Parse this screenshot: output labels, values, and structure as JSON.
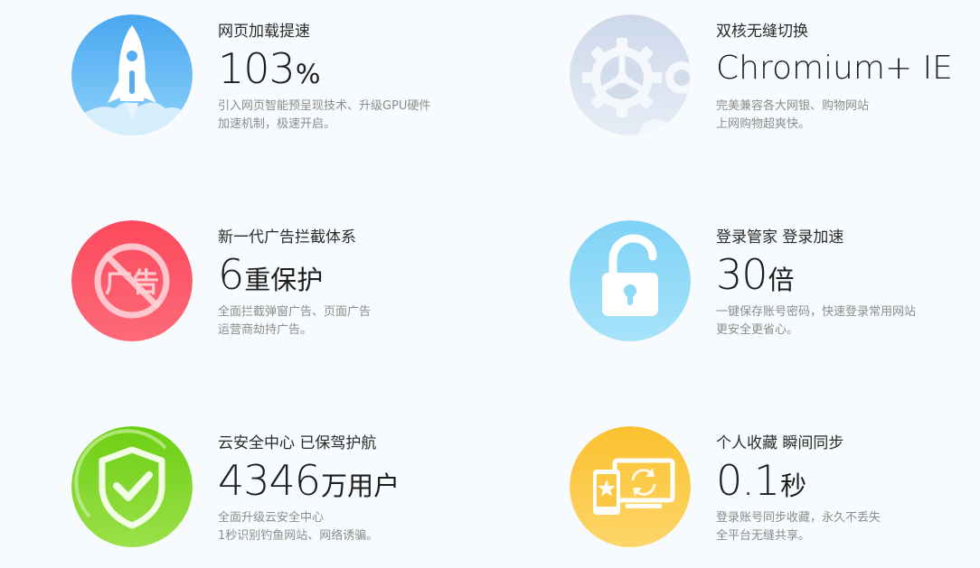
{
  "features": [
    {
      "title": "网页加载提速",
      "metric_num": "103",
      "metric_unit": "%",
      "desc_line1": "引入网页智能预呈现技术、升级GPU硬件",
      "desc_line2": "加速机制，极速开启。",
      "icon": "rocket-icon",
      "color": "#62b8f5"
    },
    {
      "title": "双核无缝切换",
      "metric_num": "Chromium+ IE",
      "metric_unit": "",
      "desc_line1": "完美兼容各大网银、购物网站",
      "desc_line2": "上网购物超爽快。",
      "icon": "gear-icon",
      "color": "#d7e1ef"
    },
    {
      "title": "新一代广告拦截体系",
      "metric_num": "6",
      "metric_unit": "重保护",
      "desc_line1": "全面拦截弹窗广告、页面广告",
      "desc_line2": "运营商劫持广告。",
      "icon": "no-ads-icon",
      "icon_text": "广告",
      "color": "#fb4f62"
    },
    {
      "title": "登录管家 登录加速",
      "metric_num": "30",
      "metric_unit": "倍",
      "desc_line1": "一键保存账号密码，快速登录常用网站",
      "desc_line2": "更安全更省心。",
      "icon": "unlock-icon",
      "color": "#8ed8f7"
    },
    {
      "title": "云安全中心 已保驾护航",
      "metric_num": "4346",
      "metric_unit": "万用户",
      "desc_line1": "全面升级云安全中心",
      "desc_line2": "1秒识别钓鱼网站、网络诱骗。",
      "icon": "shield-check-icon",
      "color": "#74d41e"
    },
    {
      "title": "个人收藏 瞬间同步",
      "metric_num": "0.1",
      "metric_unit": "秒",
      "desc_line1": "登录账号同步收藏，永久不丢失",
      "desc_line2": "全平台无缝共享。",
      "icon": "sync-devices-icon",
      "color": "#fcc843"
    }
  ]
}
